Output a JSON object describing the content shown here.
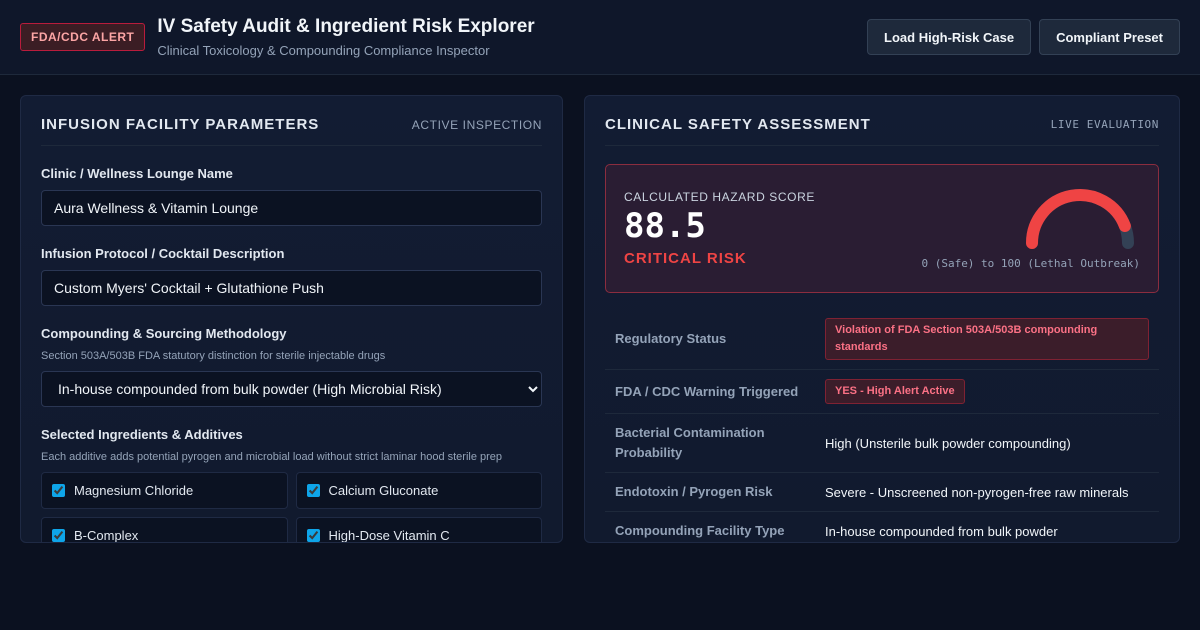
{
  "header": {
    "alert_badge": "FDA/CDC ALERT",
    "title": "IV Safety Audit & Ingredient Risk Explorer",
    "subtitle": "Clinical Toxicology & Compounding Compliance Inspector",
    "buttons": {
      "load_high_risk": "Load High-Risk Case",
      "compliant_preset": "Compliant Preset"
    }
  },
  "left_panel": {
    "title": "INFUSION FACILITY PARAMETERS",
    "tag": "ACTIVE INSPECTION",
    "clinic_name": {
      "label": "Clinic / Wellness Lounge Name",
      "value": "Aura Wellness & Vitamin Lounge"
    },
    "protocol": {
      "label": "Infusion Protocol / Cocktail Description",
      "value": "Custom Myers' Cocktail + Glutathione Push"
    },
    "methodology": {
      "label": "Compounding & Sourcing Methodology",
      "help": "Section 503A/503B FDA statutory distinction for sterile injectable drugs",
      "selected": "In-house compounded from bulk powder (High Microbial Risk)"
    },
    "ingredients": {
      "label": "Selected Ingredients & Additives",
      "help": "Each additive adds potential pyrogen and microbial load without strict laminar hood sterile prep",
      "items": [
        {
          "label": "Magnesium Chloride",
          "checked": true
        },
        {
          "label": "Calcium Gluconate",
          "checked": true
        },
        {
          "label": "B-Complex",
          "checked": true
        },
        {
          "label": "High-Dose Vitamin C",
          "checked": true
        }
      ]
    }
  },
  "right_panel": {
    "title": "CLINICAL SAFETY ASSESSMENT",
    "tag": "LIVE EVALUATION",
    "score": {
      "label": "CALCULATED HAZARD SCORE",
      "value": "88.5",
      "level": "CRITICAL RISK",
      "scale": "0 (Safe) to 100 (Lethal Outbreak)",
      "fraction": 0.885
    },
    "rows": [
      {
        "key": "Regulatory Status",
        "value": "Violation of FDA Section 503A/503B compounding standards",
        "tag": true
      },
      {
        "key": "FDA / CDC Warning Triggered",
        "value": "YES - High Alert Active",
        "tag": true
      },
      {
        "key": "Bacterial Contamination Probability",
        "value": "High (Unsterile bulk powder compounding)",
        "tag": false
      },
      {
        "key": "Endotoxin / Pyrogen Risk",
        "value": "Severe - Unscreened non-pyrogen-free raw minerals",
        "tag": false
      },
      {
        "key": "Compounding Facility Type",
        "value": "In-house compounded from bulk powder",
        "tag": false
      }
    ]
  },
  "colors": {
    "critical": "#ef4444",
    "gauge_track": "#334155",
    "accent": "#0ea5e9"
  }
}
